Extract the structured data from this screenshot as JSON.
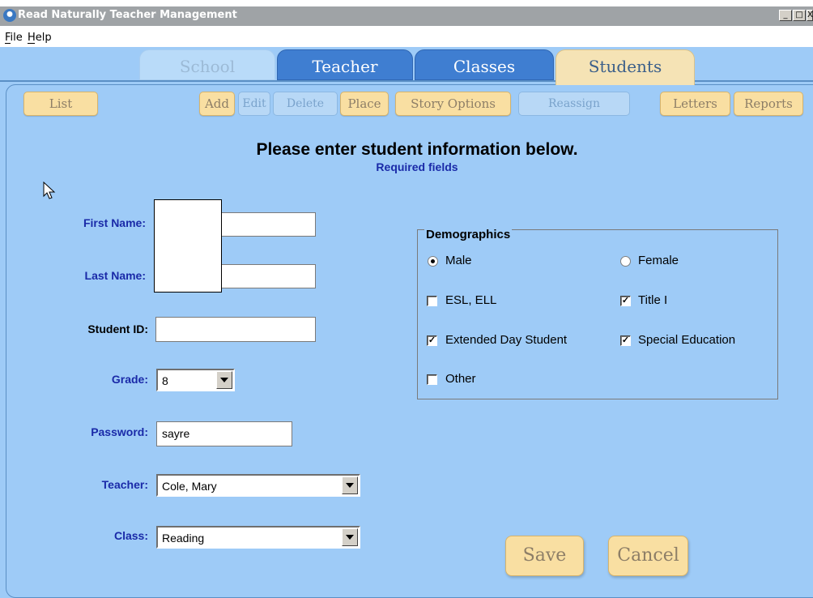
{
  "window": {
    "title": "Read Naturally Teacher Management",
    "controls": [
      "_",
      "□",
      "X"
    ]
  },
  "menu": {
    "items": [
      "File",
      "Help"
    ]
  },
  "tabs": [
    {
      "label": "School",
      "state": "disabled"
    },
    {
      "label": "Teacher",
      "state": "normal"
    },
    {
      "label": "Classes",
      "state": "normal"
    },
    {
      "label": "Students",
      "state": "active"
    }
  ],
  "toolbar": {
    "list": "List",
    "add": "Add",
    "edit": "Edit",
    "delete": "Delete",
    "place": "Place",
    "story_options": "Story Options",
    "reassign": "Reassign",
    "letters": "Letters",
    "reports": "Reports"
  },
  "form": {
    "heading": "Please enter student information below.",
    "required_note": "Required fields",
    "first_name": {
      "label": "First Name:",
      "value": ""
    },
    "last_name": {
      "label": "Last Name:",
      "value": ""
    },
    "student_id": {
      "label": "Student ID:",
      "value": ""
    },
    "grade": {
      "label": "Grade:",
      "value": "8"
    },
    "password": {
      "label": "Password:",
      "value": "sayre"
    },
    "teacher": {
      "label": "Teacher:",
      "value": "Cole, Mary"
    },
    "class": {
      "label": "Class:",
      "value": "Reading"
    }
  },
  "demographics": {
    "title": "Demographics",
    "male": {
      "label": "Male",
      "selected": true
    },
    "female": {
      "label": "Female",
      "selected": false
    },
    "esl": {
      "label": "ESL, ELL",
      "checked": false
    },
    "title1": {
      "label": "Title I",
      "checked": true
    },
    "extended_day": {
      "label": "Extended Day Student",
      "checked": true
    },
    "special_ed": {
      "label": "Special Education",
      "checked": true
    },
    "other": {
      "label": "Other",
      "checked": false
    }
  },
  "actions": {
    "save": "Save",
    "cancel": "Cancel"
  },
  "colors": {
    "background": "#9ecbf7",
    "active_tab": "#f5e3b5",
    "tab_blue": "#3f7ed1",
    "button": "#f9dfa2",
    "required_label": "#1a2aa8"
  }
}
